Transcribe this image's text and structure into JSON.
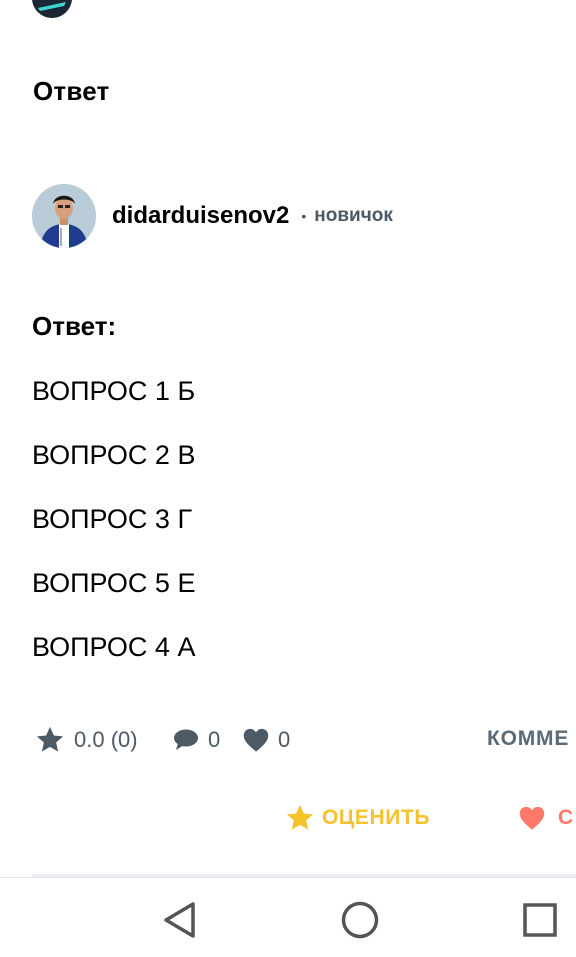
{
  "top": {
    "avatar_icon": "user-avatar-icon"
  },
  "section": {
    "title": "Ответ"
  },
  "author": {
    "avatar_icon": "user-avatar-icon",
    "name": "didarduisenov2",
    "separator": "•",
    "rank": "новичок"
  },
  "answer": {
    "label": "Ответ:",
    "lines": [
      "ВОПРОС 1 Б",
      "ВОПРОС 2 В",
      "ВОПРОС 3 Г",
      "ВОПРОС 5 Е",
      "ВОПРОС 4 А"
    ]
  },
  "stats": {
    "rating": "0.0 (0)",
    "comments": "0",
    "likes": "0",
    "comments_link": "КОММЕ"
  },
  "actions": {
    "rate_label": "ОЦЕНИТЬ",
    "thanks_label": "С"
  },
  "nav": {
    "back_icon": "triangle-back-icon",
    "home_icon": "circle-home-icon",
    "recent_icon": "square-recent-icon"
  },
  "colors": {
    "text": "#000000",
    "muted": "#4c5a66",
    "rate": "#f5c22d",
    "thanks": "#ff7968"
  }
}
